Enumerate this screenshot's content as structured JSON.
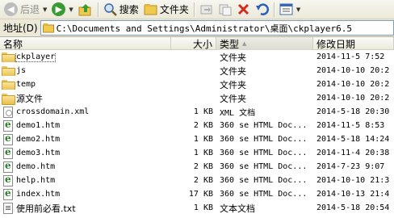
{
  "toolbar": {
    "back_label": "后退",
    "search_label": "搜索",
    "folders_label": "文件夹"
  },
  "address": {
    "label": "地址(D)",
    "path": "C:\\Documents and Settings\\Administrator\\桌面\\ckplayer6.5"
  },
  "columns": {
    "name": "名称",
    "size": "大小",
    "type": "类型",
    "date": "修改日期"
  },
  "files": [
    {
      "name": "ckplayer",
      "size": "",
      "type": "文件夹",
      "date": "2014-11-5 7:52",
      "icon": "folder",
      "selected": true
    },
    {
      "name": "js",
      "size": "",
      "type": "文件夹",
      "date": "2014-10-10 20:2",
      "icon": "folder"
    },
    {
      "name": "temp",
      "size": "",
      "type": "文件夹",
      "date": "2014-10-10 20:2",
      "icon": "folder"
    },
    {
      "name": "源文件",
      "size": "",
      "type": "文件夹",
      "date": "2014-10-10 20:2",
      "icon": "folder"
    },
    {
      "name": "crossdomain.xml",
      "size": "1 KB",
      "type": "XML 文档",
      "date": "2014-5-18 20:30",
      "icon": "xml"
    },
    {
      "name": "demo1.htm",
      "size": "2 KB",
      "type": "360 se HTML Doc...",
      "date": "2014-11-5 8:53",
      "icon": "html"
    },
    {
      "name": "demo2.htm",
      "size": "1 KB",
      "type": "360 se HTML Doc...",
      "date": "2014-5-18 14:24",
      "icon": "html"
    },
    {
      "name": "demo3.htm",
      "size": "1 KB",
      "type": "360 se HTML Doc...",
      "date": "2014-11-4 20:38",
      "icon": "html"
    },
    {
      "name": "demo.htm",
      "size": "2 KB",
      "type": "360 se HTML Doc...",
      "date": "2014-7-23 9:07",
      "icon": "html"
    },
    {
      "name": "help.htm",
      "size": "2 KB",
      "type": "360 se HTML Doc...",
      "date": "2014-10-10 21:3",
      "icon": "html"
    },
    {
      "name": "index.htm",
      "size": "17 KB",
      "type": "360 se HTML Doc...",
      "date": "2014-10-13 21:4",
      "icon": "html"
    },
    {
      "name": "使用前必看.txt",
      "size": "1 KB",
      "type": "文本文档",
      "date": "2014-5-18 20:54",
      "icon": "txt"
    }
  ]
}
